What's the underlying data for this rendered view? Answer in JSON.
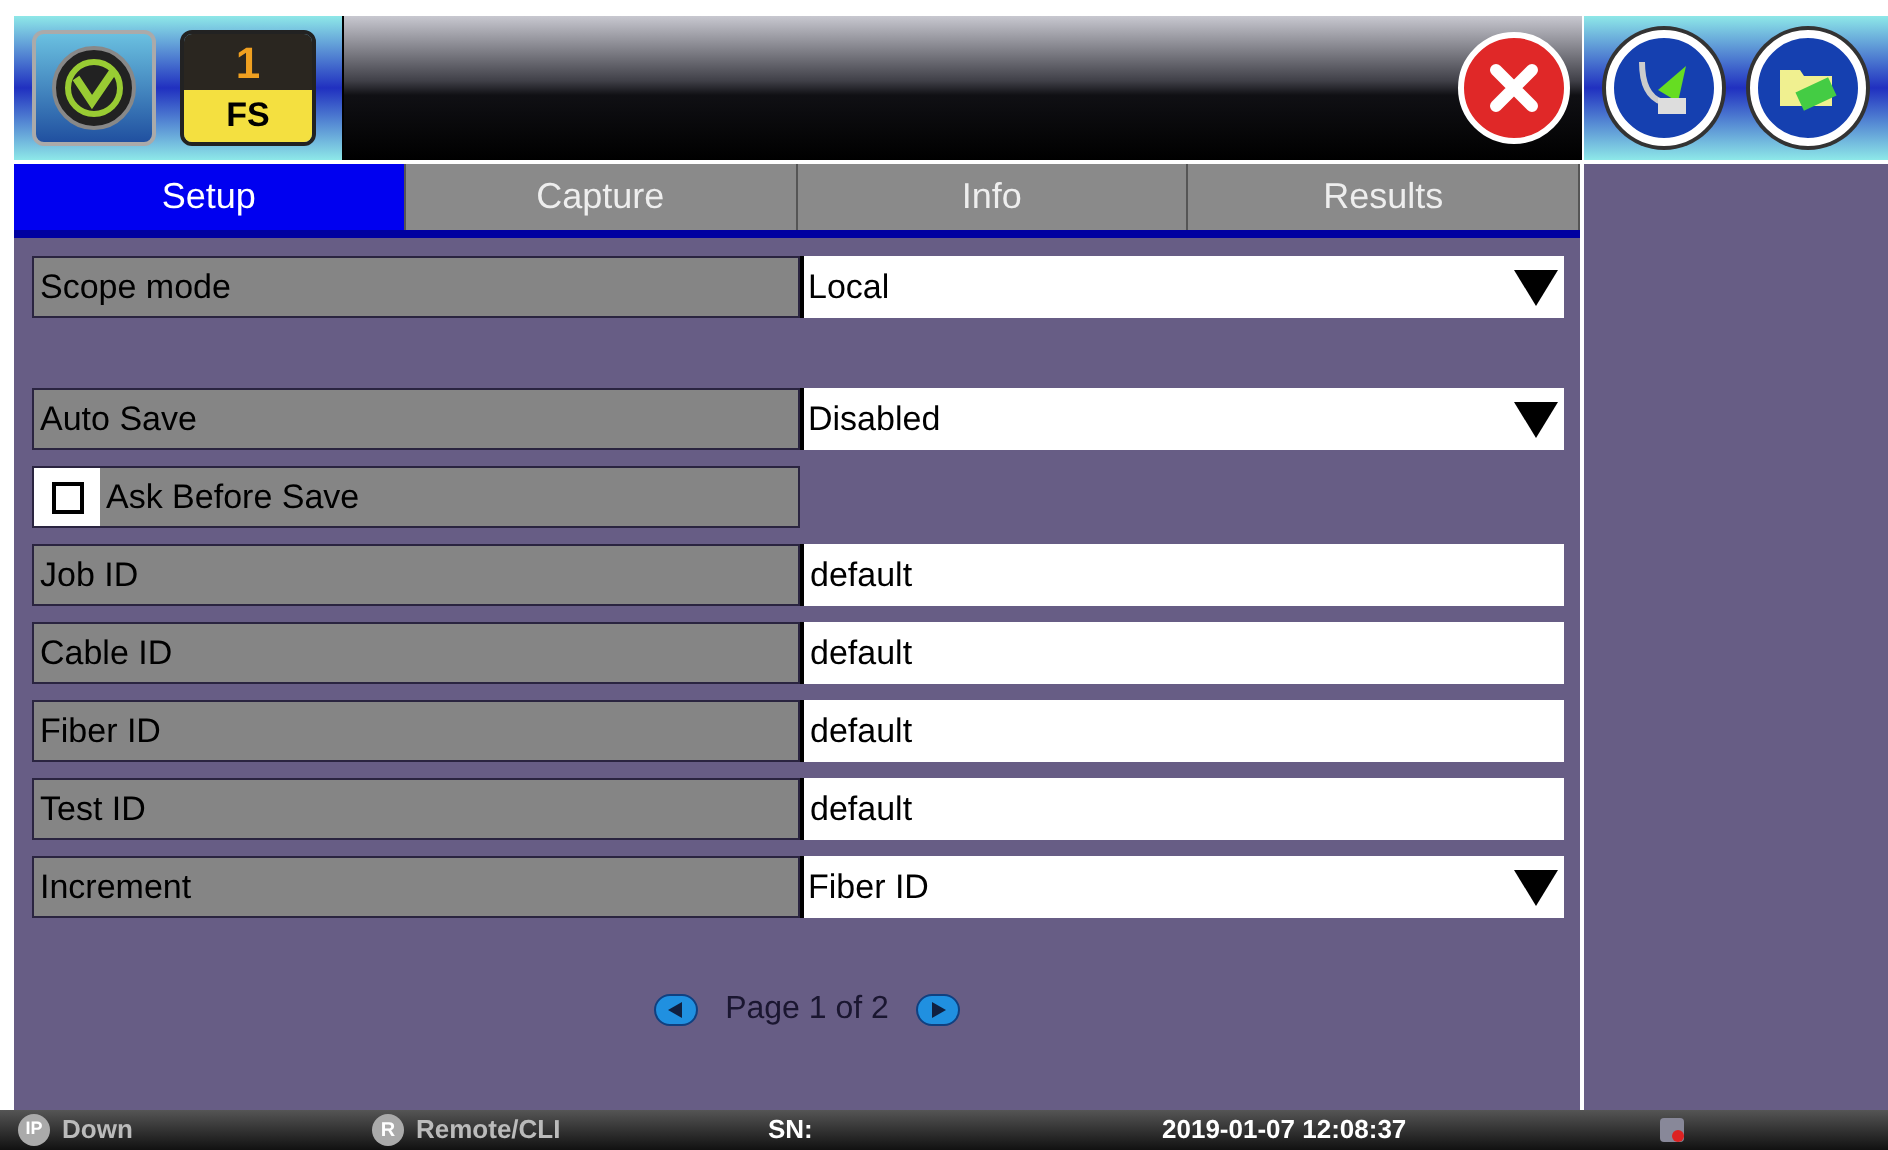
{
  "header": {
    "badge_number": "1",
    "badge_label": "FS"
  },
  "tabs": [
    {
      "label": "Setup",
      "selected": true
    },
    {
      "label": "Capture",
      "selected": false
    },
    {
      "label": "Info",
      "selected": false
    },
    {
      "label": "Results",
      "selected": false
    }
  ],
  "sections": [
    [
      {
        "kind": "dropdown",
        "label": "Scope mode",
        "value": "Local"
      }
    ],
    [
      {
        "kind": "dropdown",
        "label": "Auto Save",
        "value": "Disabled"
      },
      {
        "kind": "checkbox",
        "label": "Ask Before Save",
        "checked": false
      },
      {
        "kind": "text",
        "label": "Job ID",
        "value": "default"
      },
      {
        "kind": "text",
        "label": "Cable ID",
        "value": "default"
      },
      {
        "kind": "text",
        "label": "Fiber ID",
        "value": "default"
      },
      {
        "kind": "text",
        "label": "Test ID",
        "value": "default"
      },
      {
        "kind": "dropdown",
        "label": "Increment",
        "value": "Fiber ID"
      }
    ]
  ],
  "pager": "Page 1 of 2",
  "status_bar": {
    "ip_badge": "IP",
    "ip_status": "Down",
    "remote_badge": "R",
    "remote": "Remote/CLI",
    "sn_label": "SN:",
    "datetime": "2019-01-07  12:08:37"
  }
}
